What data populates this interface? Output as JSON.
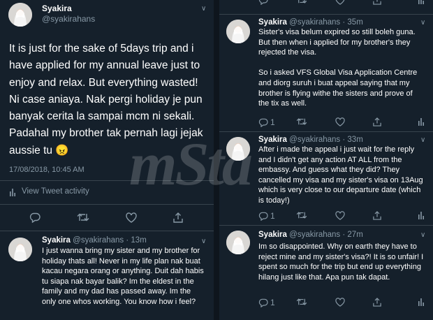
{
  "user": {
    "name": "Syakira",
    "handle": "@syakirahans"
  },
  "main_tweet": {
    "text": "It is just for the sake of 5days trip and i have applied for my annual leave just to enjoy and relax. But everything wasted! Ni case aniaya. Nak pergi holiday je pun banyak cerita la sampai mcm ni sekali. Padahal my brother tak pernah lagi jejak aussie tu 😠",
    "timestamp": "17/08/2018, 10:45 AM",
    "activity_label": "View Tweet activity"
  },
  "left_reply": {
    "time": "· 13m",
    "text": "I just wanna bring my sister and my brother for holiday thats all! Never in my life plan nak buat kacau negara orang or anything. Duit dah habis tu siapa nak bayar balik? Im the eldest in the family and my dad has passed away. Im the only one whos working. You know how i feel?"
  },
  "right_tweets": [
    {
      "time": "· 35m",
      "text": "Sister's visa belum expired so still boleh guna. But then when i applied for my brother's they rejected the visa.\n\nSo i asked VFS Global Visa Application Centre and diorg suruh i buat appeal saying that my brother is flying withe the sisters and prove of the tix as well.",
      "reply_count": "1"
    },
    {
      "time": "· 33m",
      "text": "After i made the appeal i just wait for the reply and I didn't get any action AT ALL from the embassy. And guess what they did? They cancelled my visa and my sister's visa on 13Aug which is very close to our departure date (which is today!)",
      "reply_count": "1"
    },
    {
      "time": "· 27m",
      "text": "Im so disappointed. Why on earth they have to reject mine and my sister's visa?! It is so unfair! I spent so much for the trip but end up everything hilang just like that. Apa pun tak dapat.",
      "reply_count": "1"
    }
  ],
  "watermark": "mSta",
  "icons": {
    "reply": "reply-icon",
    "retweet": "retweet-icon",
    "like": "like-icon",
    "analytics": "analytics-icon",
    "chevron": "chevron-down-icon",
    "avatar": "avatar"
  },
  "colors": {
    "background": "#15202b",
    "secondary_text": "#8899a6",
    "border": "#38444d"
  }
}
